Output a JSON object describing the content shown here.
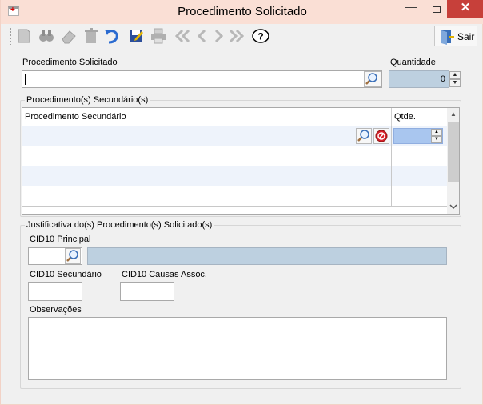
{
  "window": {
    "title": "Procedimento Solicitado",
    "minimize_glyph": "—",
    "close_glyph": "✕"
  },
  "toolbar": {
    "icons": [
      "new-record-icon",
      "search-binoculars-icon",
      "erase-icon",
      "delete-trash-icon",
      "undo-icon",
      "save-edit-icon",
      "print-icon",
      "first-record-icon",
      "previous-record-icon",
      "next-record-icon",
      "last-record-icon",
      "help-icon"
    ],
    "exit_label": "Sair"
  },
  "form": {
    "procedure_label": "Procedimento Solicitado",
    "procedure_value": "",
    "quantity_label": "Quantidade",
    "quantity_value": "0"
  },
  "secondary": {
    "group_title": "Procedimento(s) Secundário(s)",
    "columns": [
      "Procedimento Secundário",
      "Qtde."
    ],
    "rows": [
      {
        "procedure": "",
        "qty": ""
      },
      {
        "procedure": "",
        "qty": ""
      },
      {
        "procedure": "",
        "qty": ""
      },
      {
        "procedure": "",
        "qty": ""
      }
    ]
  },
  "justification": {
    "group_title": "Justificativa do(s) Procedimento(s) Solicitado(s)",
    "cid10_principal_label": "CID10 Principal",
    "cid10_principal_value": "",
    "cid10_principal_description": "",
    "cid10_secondary_label": "CID10 Secundário",
    "cid10_secondary_value": "",
    "cid10_causes_label": "CID10 Causas Assoc.",
    "cid10_causes_value": "",
    "observations_label": "Observações",
    "observations_value": ""
  }
}
